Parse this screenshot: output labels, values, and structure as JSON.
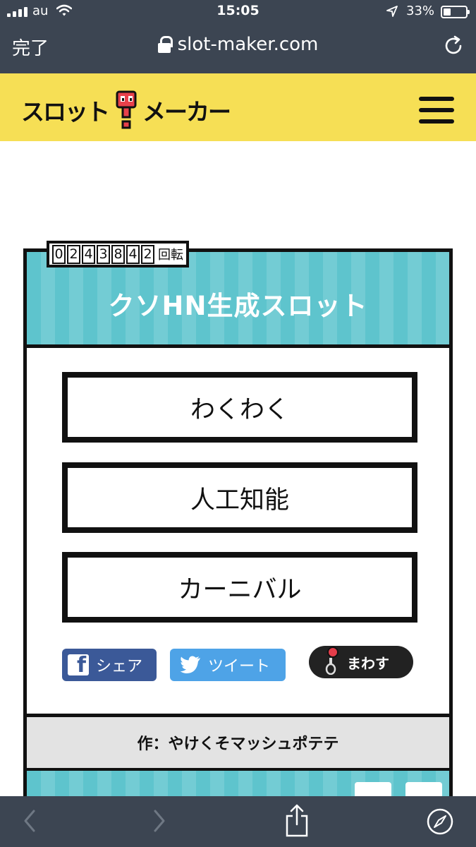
{
  "status_bar": {
    "carrier": "au",
    "time": "15:05",
    "battery_percent": "33%"
  },
  "browser": {
    "done_label": "完了",
    "url": "slot-maker.com"
  },
  "header": {
    "logo_text_left": "スロット",
    "logo_text_right": "メーカー"
  },
  "slot": {
    "spin_count_digits": [
      "0",
      "2",
      "4",
      "3",
      "8",
      "4",
      "2"
    ],
    "spin_count_unit": "回転",
    "title": "クソHN生成スロット",
    "reels": [
      "わくわく",
      "人工知能",
      "カーニバル"
    ],
    "share_facebook_label": "シェア",
    "share_twitter_label": "ツイート",
    "spin_label": "まわす",
    "author": "作：やけくそマッシュポテテ"
  },
  "colors": {
    "header_yellow": "#f6df55",
    "stripe_teal": "#5ec4cd",
    "facebook_blue": "#3b5998",
    "twitter_blue": "#4ea3e7",
    "browser_chrome": "#3c4552"
  },
  "icons": [
    "signal-icon",
    "wifi-icon",
    "location-icon",
    "battery-icon",
    "lock-icon",
    "reload-icon",
    "hamburger-menu-icon",
    "facebook-icon",
    "twitter-icon",
    "lever-icon",
    "back-icon",
    "forward-icon",
    "share-icon",
    "compass-icon"
  ]
}
